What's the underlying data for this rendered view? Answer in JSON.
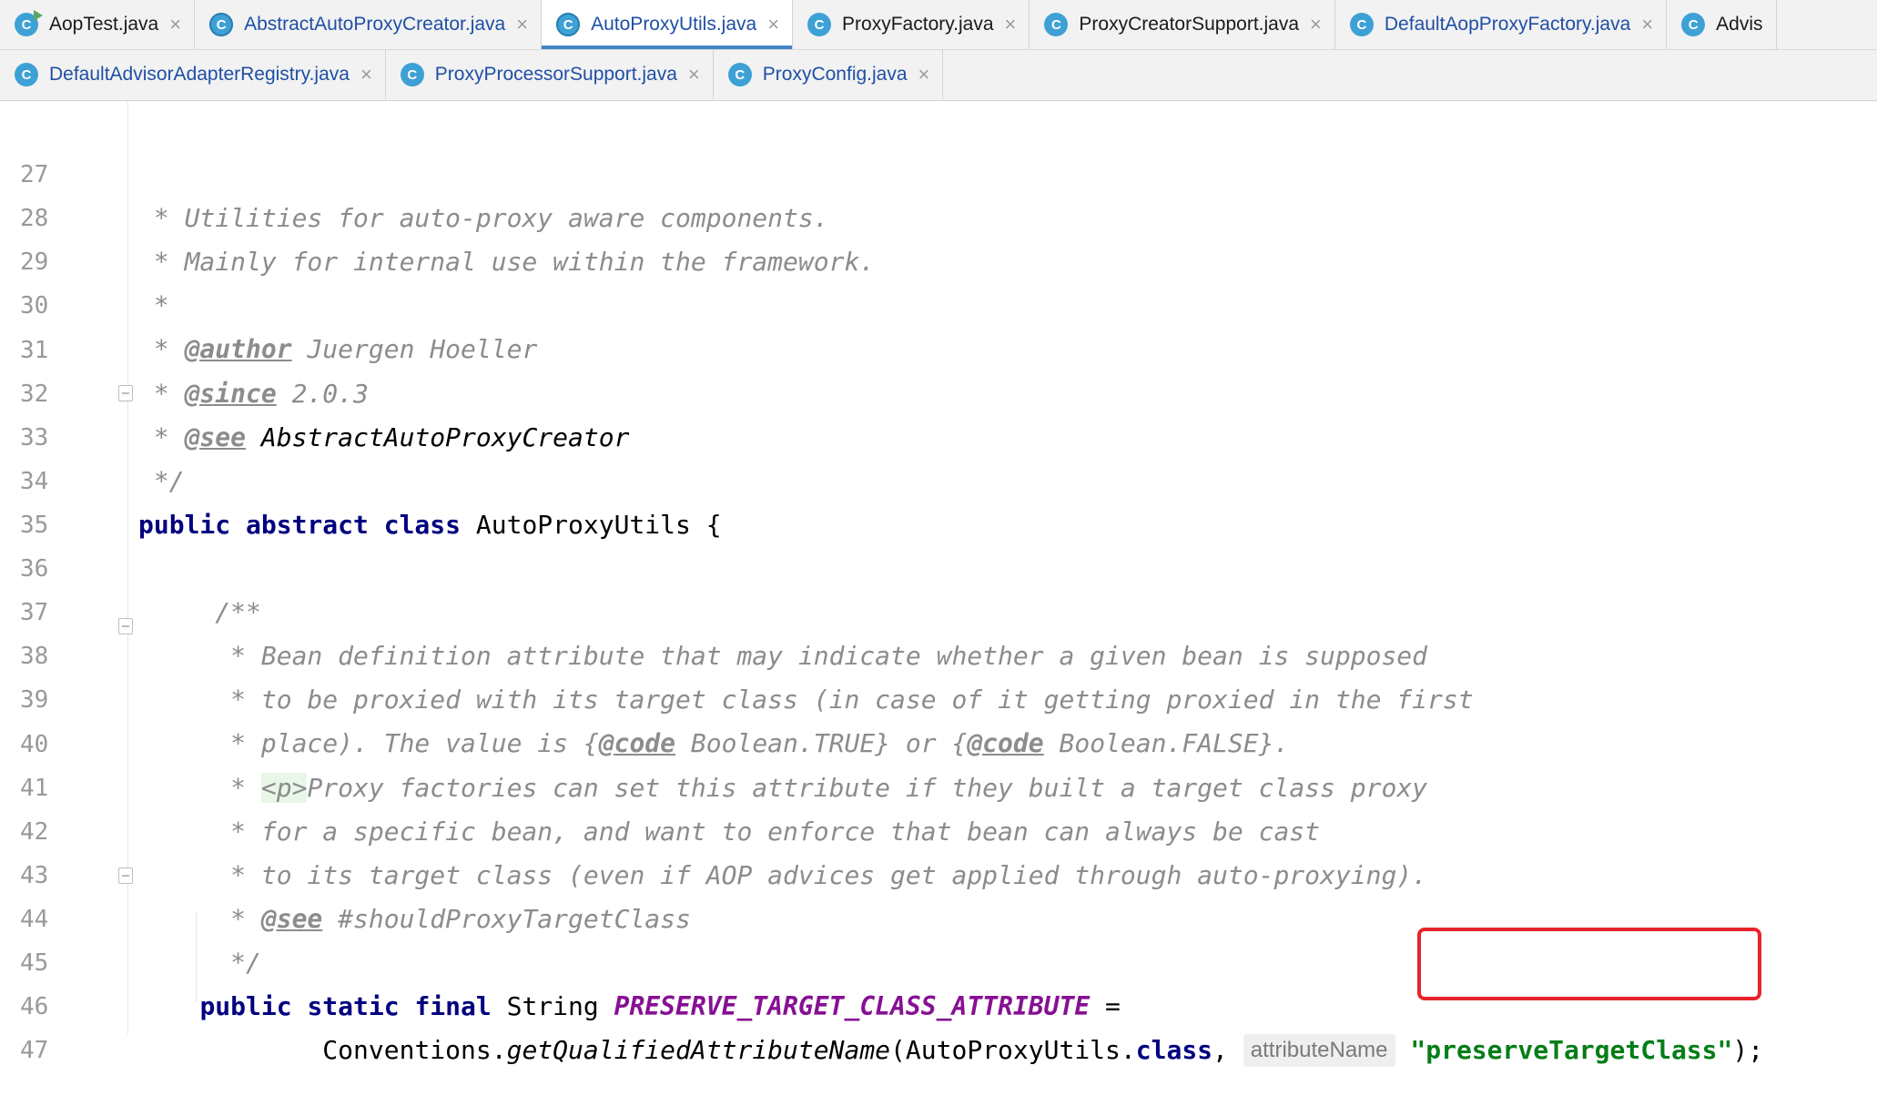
{
  "tabs_row1": [
    {
      "label": "AopTest.java",
      "icon": "class-run-icon",
      "active": false,
      "blue": false
    },
    {
      "label": "AbstractAutoProxyCreator.java",
      "icon": "abstract-class-icon",
      "active": false,
      "blue": true
    },
    {
      "label": "AutoProxyUtils.java",
      "icon": "abstract-class-icon",
      "active": true,
      "blue": true
    },
    {
      "label": "ProxyFactory.java",
      "icon": "class-icon",
      "active": false,
      "blue": false
    },
    {
      "label": "ProxyCreatorSupport.java",
      "icon": "class-icon",
      "active": false,
      "blue": false
    },
    {
      "label": "DefaultAopProxyFactory.java",
      "icon": "class-icon",
      "active": false,
      "blue": true
    },
    {
      "label": "Advis",
      "icon": "class-icon",
      "active": false,
      "blue": false
    }
  ],
  "tabs_row2": [
    {
      "label": "DefaultAdvisorAdapterRegistry.java",
      "icon": "class-icon",
      "blue": true
    },
    {
      "label": "ProxyProcessorSupport.java",
      "icon": "class-icon",
      "blue": true
    },
    {
      "label": "ProxyConfig.java",
      "icon": "class-icon",
      "blue": true
    }
  ],
  "tab_icon_letter": "C",
  "close_glyph": "×",
  "lines": {
    "l27": {
      "n": "27",
      "t": " * Utilities for auto-proxy aware components."
    },
    "l28": {
      "n": "28",
      "t": " * Mainly for internal use within the framework."
    },
    "l29": {
      "n": "29",
      "t": " *"
    },
    "l30": {
      "n": "30",
      "a": " * ",
      "tag": "@author",
      "b": " Juergen Hoeller"
    },
    "l31": {
      "n": "31",
      "a": " * ",
      "tag": "@since",
      "b": " 2.0.3"
    },
    "l32": {
      "n": "32",
      "a": " * ",
      "tag": "@see",
      "b": " AbstractAutoProxyCreator"
    },
    "l33": {
      "n": "33",
      "t": " */"
    },
    "l34": {
      "n": "34",
      "kw": "public abstract class",
      "rest": " AutoProxyUtils {"
    },
    "l35": {
      "n": "35"
    },
    "l36": {
      "n": "36",
      "t": "     /**"
    },
    "l37": {
      "n": "37",
      "t": "      * Bean definition attribute that may indicate whether a given bean is supposed"
    },
    "l38": {
      "n": "38",
      "t": "      * to be proxied with its target class (in case of it getting proxied in the first"
    },
    "l39": {
      "n": "39",
      "a": "      * place). The value is {",
      "tag1": "@code",
      "b": " Boolean.TRUE} or {",
      "tag2": "@code",
      "c": " Boolean.FALSE}."
    },
    "l40": {
      "n": "40",
      "a": "      * ",
      "html": "<p>",
      "b": "Proxy factories can set this attribute if they built a target class proxy"
    },
    "l41": {
      "n": "41",
      "t": "      * for a specific bean, and want to enforce that bean can always be cast"
    },
    "l42": {
      "n": "42",
      "t": "      * to its target class (even if AOP advices get applied through auto-proxying)."
    },
    "l43": {
      "n": "43",
      "a": "      * ",
      "tag": "@see",
      "b": " #shouldProxyTargetClass"
    },
    "l44": {
      "n": "44",
      "t": "      */"
    },
    "l45": {
      "n": "45",
      "ind": "    ",
      "kw": "public static final",
      "mid": " String ",
      "const": "PRESERVE_TARGET_CLASS_ATTRIBUTE",
      "end": " ="
    },
    "l46": {
      "n": "46",
      "ind": "            ",
      "a": "Conventions.",
      "meth": "getQualifiedAttributeName",
      "b": "(AutoProxyUtils.",
      "kw": "class",
      "c": ", ",
      "hint": "attributeName",
      "str": "\"preserveTargetClass\"",
      "end": ");"
    },
    "l47": {
      "n": "47"
    }
  }
}
